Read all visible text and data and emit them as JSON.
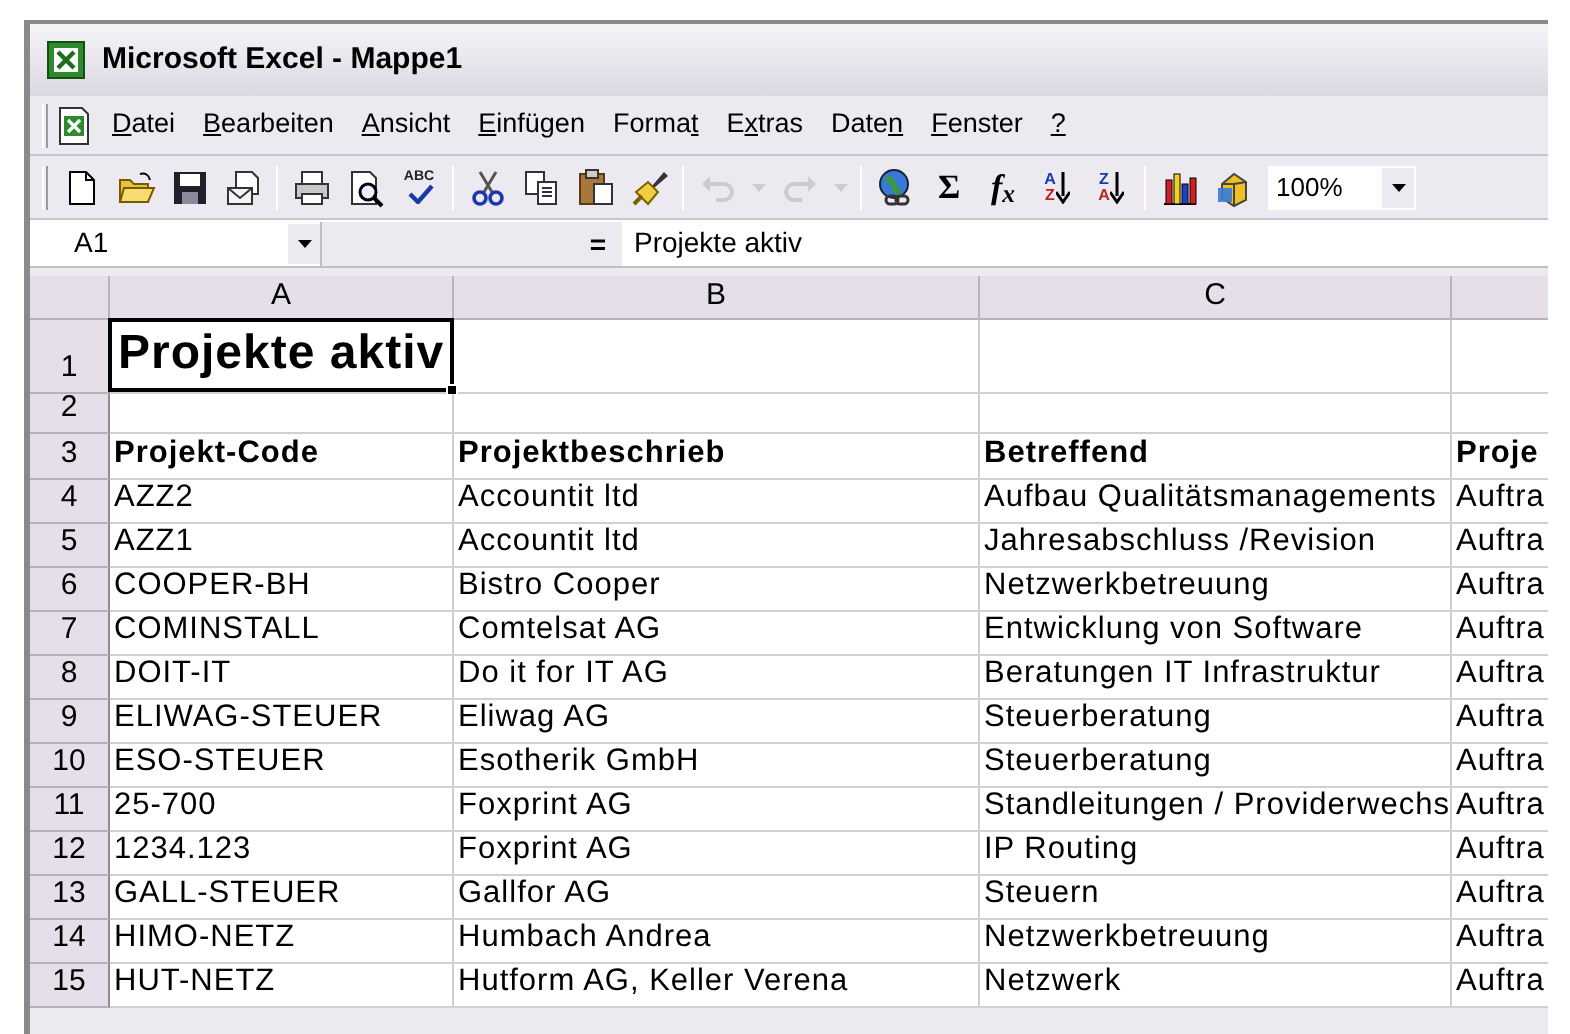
{
  "window": {
    "title": "Microsoft Excel - Mappe1"
  },
  "menu": [
    {
      "key": "D",
      "after": "atei"
    },
    {
      "key": "B",
      "after": "earbeiten"
    },
    {
      "key": "A",
      "after": "nsicht"
    },
    {
      "key": "E",
      "after": "infügen"
    },
    {
      "before": "Forma",
      "key": "t"
    },
    {
      "before": "E",
      "key": "x",
      "after": "tras"
    },
    {
      "before": "Date",
      "key": "n"
    },
    {
      "key": "F",
      "after": "enster"
    },
    {
      "key": "?"
    }
  ],
  "toolbar": [
    {
      "kind": "icon",
      "disabled": false
    },
    {
      "kind": "icon",
      "disabled": false
    },
    {
      "kind": "icon",
      "disabled": false
    },
    {
      "kind": "icon",
      "disabled": false
    },
    {
      "kind": "separator"
    },
    {
      "kind": "icon",
      "disabled": false
    },
    {
      "kind": "icon",
      "disabled": false
    },
    {
      "kind": "spell",
      "text": "ABC",
      "disabled": false
    },
    {
      "kind": "separator"
    },
    {
      "kind": "icon",
      "disabled": false
    },
    {
      "kind": "icon",
      "disabled": false
    },
    {
      "kind": "icon",
      "disabled": false
    },
    {
      "kind": "icon",
      "disabled": false
    },
    {
      "kind": "separator"
    },
    {
      "kind": "icon",
      "disabled": true
    },
    {
      "kind": "dropdown",
      "disabled": true
    },
    {
      "kind": "icon",
      "disabled": true
    },
    {
      "kind": "dropdown",
      "disabled": true
    },
    {
      "kind": "separator"
    },
    {
      "kind": "icon",
      "disabled": false
    },
    {
      "kind": "glyph",
      "text": "Σ",
      "disabled": false
    },
    {
      "kind": "glyph",
      "text": "f$_{x}$",
      "disabled": false
    },
    {
      "kind": "sort",
      "top": "A",
      "bottom": "Z",
      "disabled": false
    },
    {
      "kind": "sort",
      "top": "Z",
      "bottom": "A",
      "disabled": false
    },
    {
      "kind": "separator"
    },
    {
      "kind": "icon",
      "disabled": false
    },
    {
      "kind": "icon",
      "disabled": false
    },
    {
      "kind": "combo",
      "value": "100%"
    }
  ],
  "formula_bar": {
    "name_box": "A1",
    "equals": "=",
    "content": "Projekte aktiv"
  },
  "sheet": {
    "columns": [
      "A",
      "B",
      "C"
    ],
    "rows": [
      {
        "header": "1",
        "kind": "title",
        "cells": [
          {
            "text": "Projekte aktiv",
            "selected": true
          },
          {
            "selected": false
          },
          {
            "selected": false
          },
          {
            "selected": false
          }
        ]
      },
      {
        "header": "2",
        "kind": "blank",
        "cells": [
          {
            "selected": false
          },
          {
            "selected": false
          },
          {
            "selected": false
          },
          {
            "selected": false
          }
        ]
      },
      {
        "header": "3",
        "kind": "heading",
        "cells": [
          {
            "text": "Projekt-Code",
            "selected": false
          },
          {
            "text": "Projektbeschrieb",
            "selected": false
          },
          {
            "text": "Betreffend",
            "selected": false
          },
          {
            "text": "Proje",
            "selected": false
          }
        ]
      },
      {
        "header": "4",
        "kind": "data",
        "cells": [
          {
            "text": "AZZ2",
            "selected": false
          },
          {
            "text": "Accountit ltd",
            "selected": false
          },
          {
            "text": "Aufbau Qualitätsmanagements",
            "selected": false
          },
          {
            "text": "Auftra",
            "selected": false
          }
        ]
      },
      {
        "header": "5",
        "kind": "data",
        "cells": [
          {
            "text": "AZZ1",
            "selected": false
          },
          {
            "text": "Accountit ltd",
            "selected": false
          },
          {
            "text": "Jahresabschluss /Revision",
            "selected": false
          },
          {
            "text": "Auftra",
            "selected": false
          }
        ]
      },
      {
        "header": "6",
        "kind": "data",
        "cells": [
          {
            "text": "COOPER-BH",
            "selected": false
          },
          {
            "text": "Bistro Cooper",
            "selected": false
          },
          {
            "text": "Netzwerkbetreuung",
            "selected": false
          },
          {
            "text": "Auftra",
            "selected": false
          }
        ]
      },
      {
        "header": "7",
        "kind": "data",
        "cells": [
          {
            "text": "COMINSTALL",
            "selected": false
          },
          {
            "text": "Comtelsat AG",
            "selected": false
          },
          {
            "text": "Entwicklung von Software",
            "selected": false
          },
          {
            "text": "Auftra",
            "selected": false
          }
        ]
      },
      {
        "header": "8",
        "kind": "data",
        "cells": [
          {
            "text": "DOIT-IT",
            "selected": false
          },
          {
            "text": "Do it for IT AG",
            "selected": false
          },
          {
            "text": "Beratungen IT Infrastruktur",
            "selected": false
          },
          {
            "text": "Auftra",
            "selected": false
          }
        ]
      },
      {
        "header": "9",
        "kind": "data",
        "cells": [
          {
            "text": "ELIWAG-STEUER",
            "selected": false
          },
          {
            "text": "Eliwag AG",
            "selected": false
          },
          {
            "text": "Steuerberatung",
            "selected": false
          },
          {
            "text": "Auftra",
            "selected": false
          }
        ]
      },
      {
        "header": "10",
        "kind": "data",
        "cells": [
          {
            "text": "ESO-STEUER",
            "selected": false
          },
          {
            "text": "Esotherik GmbH",
            "selected": false
          },
          {
            "text": "Steuerberatung",
            "selected": false
          },
          {
            "text": "Auftra",
            "selected": false
          }
        ]
      },
      {
        "header": "11",
        "kind": "data",
        "cells": [
          {
            "text": "25-700",
            "selected": false
          },
          {
            "text": "Foxprint AG",
            "selected": false
          },
          {
            "text": "Standleitungen / Providerwechs",
            "selected": false
          },
          {
            "text": "Auftra",
            "selected": false
          }
        ]
      },
      {
        "header": "12",
        "kind": "data",
        "cells": [
          {
            "text": "1234.123",
            "selected": false
          },
          {
            "text": "Foxprint AG",
            "selected": false
          },
          {
            "text": "IP Routing",
            "selected": false
          },
          {
            "text": "Auftra",
            "selected": false
          }
        ]
      },
      {
        "header": "13",
        "kind": "data",
        "cells": [
          {
            "text": "GALL-STEUER",
            "selected": false
          },
          {
            "text": "Gallfor AG",
            "selected": false
          },
          {
            "text": "Steuern",
            "selected": false
          },
          {
            "text": "Auftra",
            "selected": false
          }
        ]
      },
      {
        "header": "14",
        "kind": "data",
        "cells": [
          {
            "text": "HIMO-NETZ",
            "selected": false
          },
          {
            "text": "Humbach Andrea",
            "selected": false
          },
          {
            "text": "Netzwerkbetreuung",
            "selected": false
          },
          {
            "text": "Auftra",
            "selected": false
          }
        ]
      },
      {
        "header": "15",
        "kind": "data",
        "cells": [
          {
            "text": "HUT-NETZ",
            "selected": false
          },
          {
            "text": "Hutform AG, Keller Verena",
            "selected": false
          },
          {
            "text": "Netzwerk",
            "selected": false
          },
          {
            "text": "Auftra",
            "selected": false
          }
        ]
      }
    ]
  }
}
